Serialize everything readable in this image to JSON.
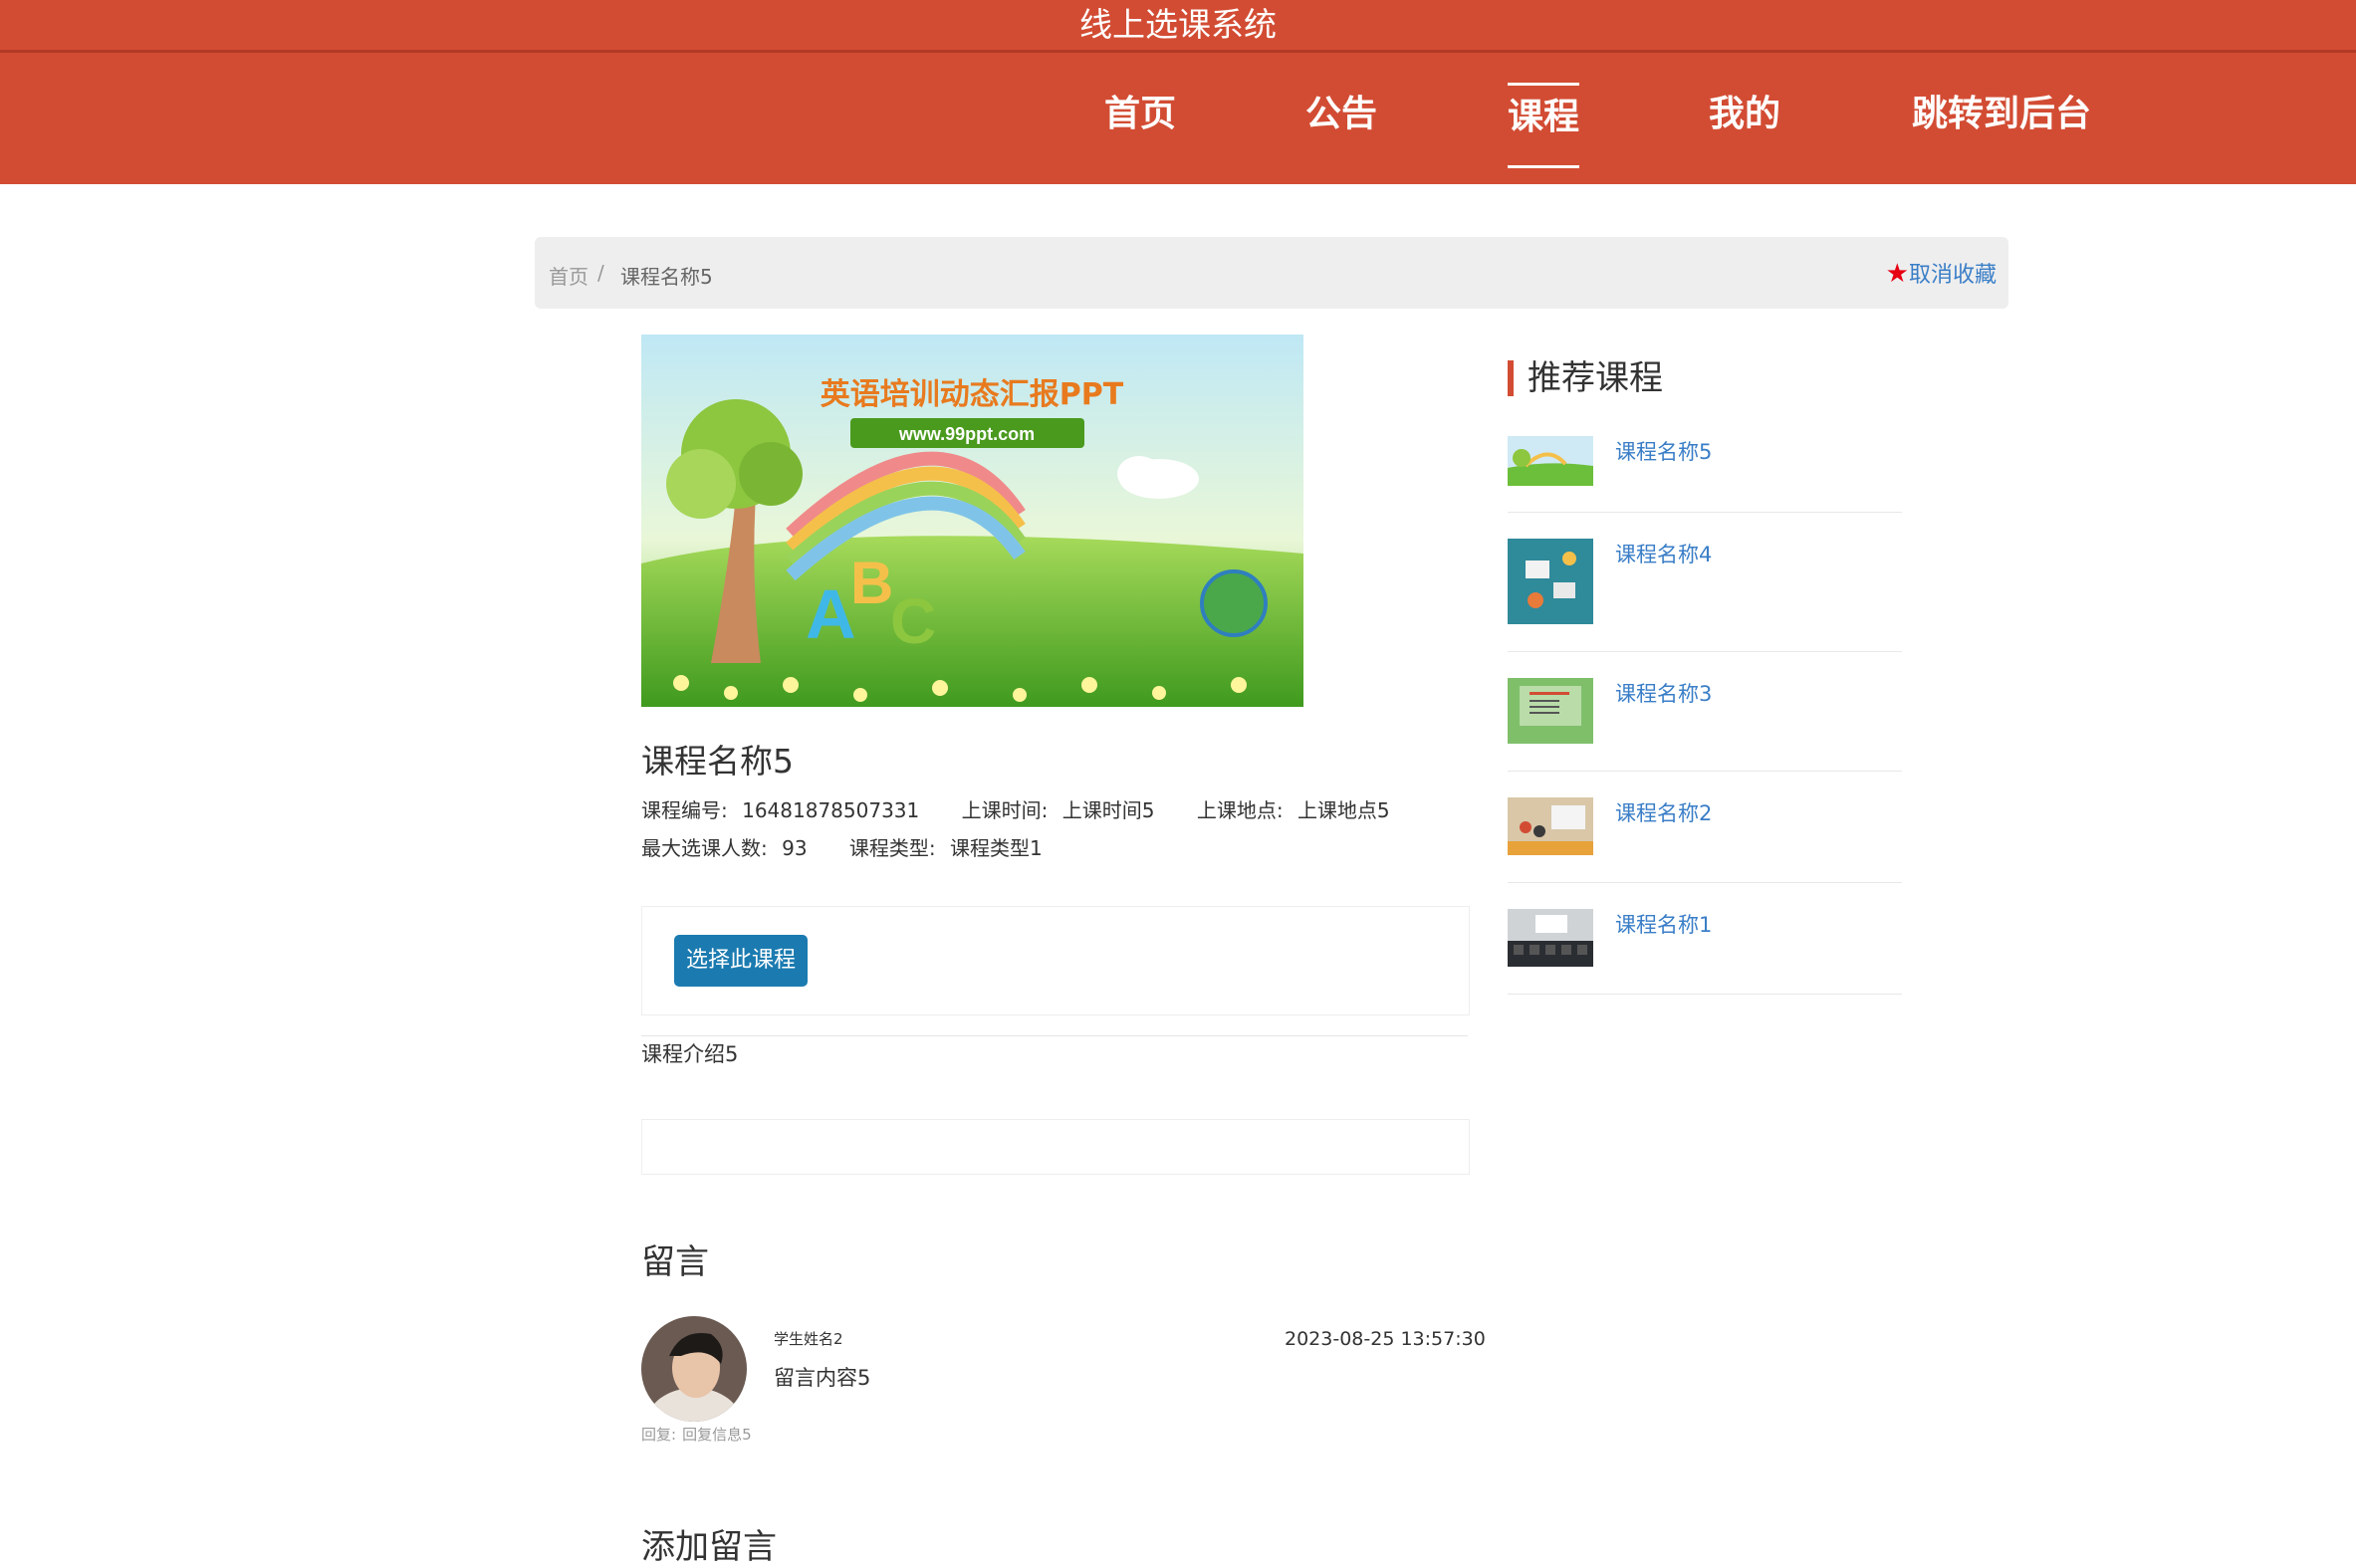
{
  "site": {
    "title": "线上选课系统"
  },
  "nav": {
    "items": [
      {
        "label": "首页",
        "active": false
      },
      {
        "label": "公告",
        "active": false
      },
      {
        "label": "课程",
        "active": true
      },
      {
        "label": "我的",
        "active": false
      },
      {
        "label": "跳转到后台",
        "active": false
      }
    ]
  },
  "breadcrumb": {
    "home": "首页",
    "separator": "/",
    "current": "课程名称5"
  },
  "favorite": {
    "label": "取消收藏",
    "icon": "star-icon"
  },
  "course": {
    "image_title": "英语培训动态汇报PPT",
    "image_url_text": "www.99ppt.com",
    "title": "课程名称5",
    "code_label": "课程编号:",
    "code": "16481878507331",
    "time_label": "上课时间:",
    "time": "上课时间5",
    "place_label": "上课地点:",
    "place": "上课地点5",
    "max_label": "最大选课人数:",
    "max": "93",
    "type_label": "课程类型:",
    "type": "课程类型1",
    "select_button": "选择此课程",
    "intro": "课程介绍5"
  },
  "comments": {
    "title": "留言",
    "items": [
      {
        "name": "学生姓名2",
        "content": "留言内容5",
        "time": "2023-08-25 13:57:30",
        "reply_label": "回复:",
        "reply": "回复信息5"
      }
    ],
    "add_title": "添加留言"
  },
  "sidebar": {
    "title": "推荐课程",
    "items": [
      {
        "name": "课程名称5"
      },
      {
        "name": "课程名称4"
      },
      {
        "name": "课程名称3"
      },
      {
        "name": "课程名称2"
      },
      {
        "name": "课程名称1"
      }
    ]
  },
  "colors": {
    "brand": "#d24c33",
    "button": "#1b7bb0",
    "link": "#3a7ec7",
    "star": "#e60012"
  }
}
